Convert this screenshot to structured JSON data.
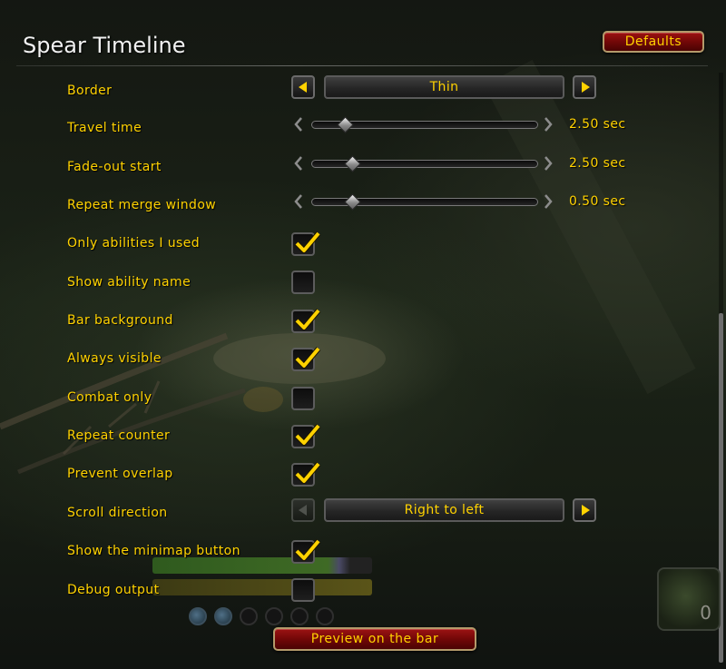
{
  "window": {
    "title": "Spear Timeline",
    "defaults_label": "Defaults",
    "preview_label": "Preview on the bar"
  },
  "settings": {
    "border": {
      "label": "Border",
      "value": "Thin"
    },
    "sliders": [
      {
        "label": "Travel time",
        "value_text": "2.50 sec",
        "fraction": 0.15
      },
      {
        "label": "Fade-out start",
        "value_text": "2.50 sec",
        "fraction": 0.18
      },
      {
        "label": "Repeat merge window",
        "value_text": "0.50 sec",
        "fraction": 0.18
      }
    ],
    "checkboxes": [
      {
        "label": "Only abilities I used",
        "checked": true
      },
      {
        "label": "Show ability name",
        "checked": false
      },
      {
        "label": "Bar background",
        "checked": true
      },
      {
        "label": "Always visible",
        "checked": true
      },
      {
        "label": "Combat only",
        "checked": false
      },
      {
        "label": "Repeat counter",
        "checked": true
      },
      {
        "label": "Prevent overlap",
        "checked": true
      }
    ],
    "scroll_direction": {
      "label": "Scroll direction",
      "value": "Right to left"
    },
    "lower_checkboxes": [
      {
        "label": "Show the minimap button",
        "checked": true
      },
      {
        "label": "Debug output",
        "checked": false
      }
    ]
  },
  "minimap_widget": {
    "count": "0"
  },
  "colors": {
    "label": "#ffd200",
    "button_red": "#8a0c0c",
    "check": "#ffd200"
  },
  "icons": [
    "arrow-left-icon",
    "arrow-right-icon",
    "chevron-left-icon",
    "chevron-right-icon",
    "checkmark-icon"
  ]
}
